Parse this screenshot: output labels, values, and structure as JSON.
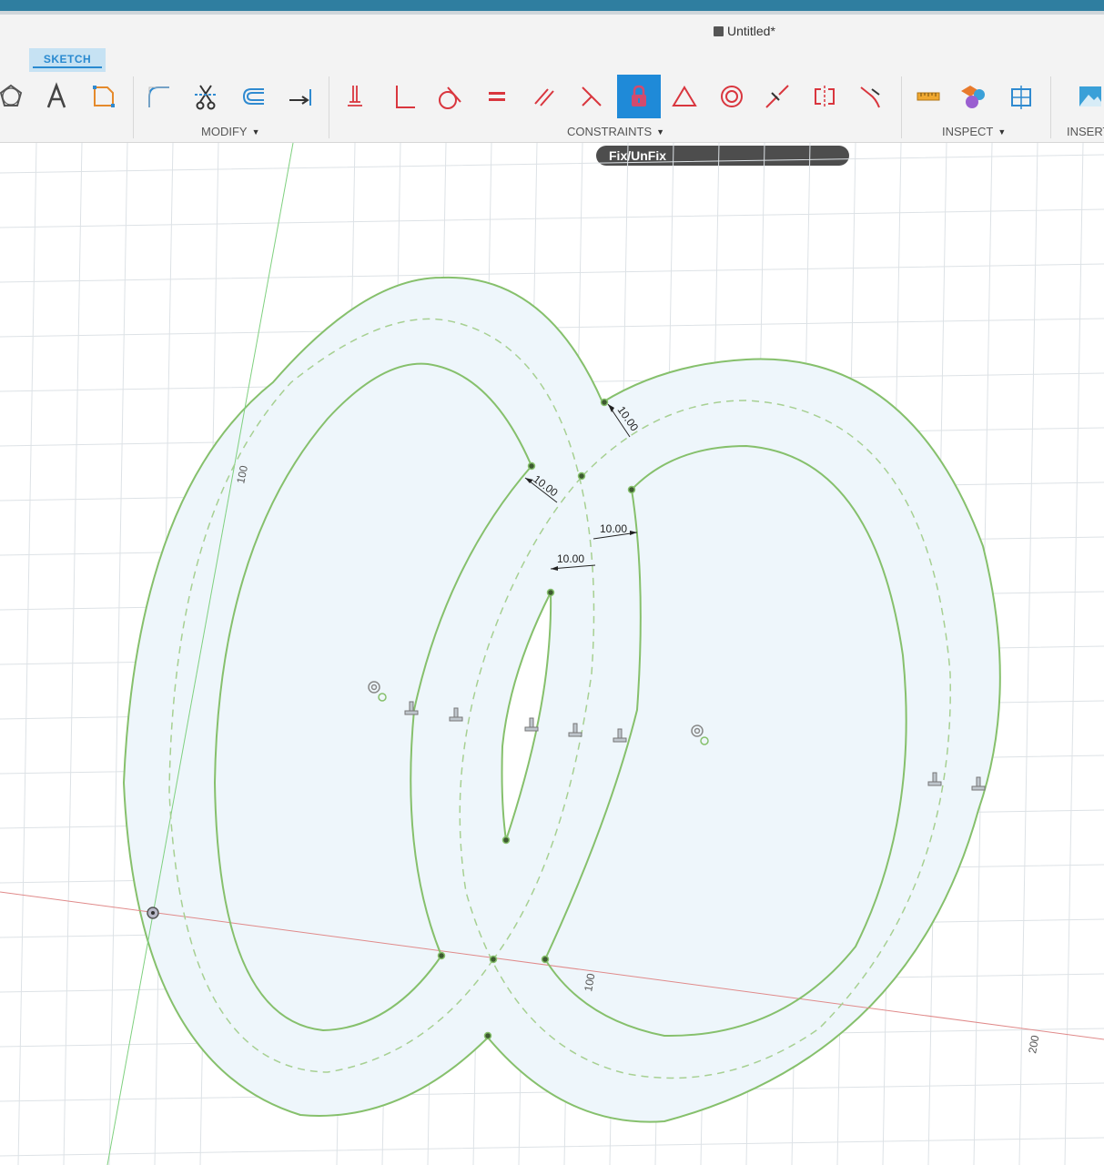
{
  "window": {
    "doc_title": "Untitled*",
    "active_tab": "SKETCH"
  },
  "toolbar": {
    "groups": {
      "modify": "MODIFY",
      "constraints": "CONSTRAINTS",
      "inspect": "INSPECT",
      "insert": "INSERT"
    },
    "tool_icons": {
      "polygon": "polygon-icon",
      "text": "text-icon",
      "fit_point_spline": "fit-point-spline-icon",
      "fillet": "fillet-icon",
      "trim": "trim-icon",
      "offset": "offset-icon",
      "extend": "extend-icon",
      "horizontal_vertical": "horizontal-vertical-constraint-icon",
      "perpendicular": "perpendicular-constraint-icon",
      "tangent": "tangent-constraint-icon",
      "equal": "equal-constraint-icon",
      "parallel": "parallel-constraint-icon",
      "coincident": "coincident-constraint-icon",
      "fix_unfix": "lock-icon",
      "midpoint": "midpoint-constraint-icon",
      "concentric": "concentric-constraint-icon",
      "collinear": "collinear-constraint-icon",
      "symmetry": "symmetry-constraint-icon",
      "curvature": "curvature-constraint-icon",
      "measure": "measure-icon",
      "display_component_colors": "component-colors-icon",
      "section_analysis": "section-analysis-icon",
      "insert_image": "insert-image-icon"
    },
    "active_tool": "Fix/UnFix"
  },
  "tooltip": {
    "text": "Fix/UnFix"
  },
  "canvas": {
    "dimensions": [
      "10.00",
      "10.00",
      "10.00",
      "10.00"
    ],
    "axis_labels": {
      "x_100": "100",
      "x_200": "200",
      "y_100": "100"
    },
    "colors": {
      "profile_fill": "#eef6fb",
      "sketch_line": "#86c06c",
      "construction_line": "#a7d092",
      "x_axis": "#e08a8a",
      "y_axis": "#7fd07f",
      "grid": "#dde2e6",
      "accent": "#1f8ad8"
    }
  }
}
